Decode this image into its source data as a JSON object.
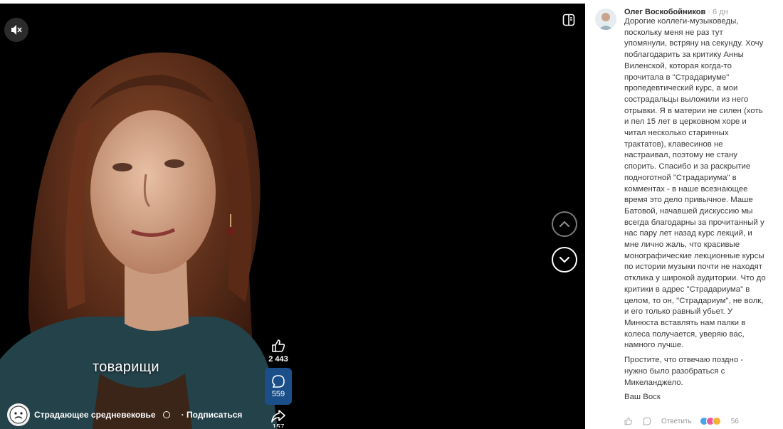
{
  "video": {
    "subtitle": "товарищи",
    "channel_name": "Страдающее средневековье",
    "subscribe_label": "· Подписаться",
    "likes_count": "2 443",
    "comments_count": "559",
    "shares_count": "157"
  },
  "comment": {
    "author": "Олег Воскобойников",
    "time": " · 6 дн",
    "paragraphs": [
      "Дорогие коллеги-музыковеды, поскольку меня не раз тут упомянули, встряну на секунду. Хочу поблагодарить за критику Анны Виленской, которая когда-то прочитала в \"Страдариуме\" пропедевтический курс, а мои сострадальцы выложили из него отрывки. Я в материи не силен (хоть и пел 15 лет в церковном хоре и читал несколько старинных трактатов), клавесинов не настраивал, поэтому не стану спорить. Спасибо и за раскрытие подноготной \"Страдариума\" в комментах - в наше всезнающее время это дело привычное. Маше Батовой, начавшей дискуссию мы всегда благодарны за прочитанный у нас пару лет назад курс лекций, и мне лично жаль, что красивые монографические лекционные курсы по истории музыки почти не находят отклика у широкой аудитории. Что до критики в адрес \"Страдариума\" в целом, то он, \"Страдариум\", не волк, и его только равный убьет. У Минюста вставлять нам палки в колеса получается, уверяю вас, намного лучше.",
      "Простите, что отвечаю поздно - нужно было разобраться с Микеланджело.",
      "Ваш Воск"
    ],
    "reply_label": "Ответить",
    "reactions_count": "56"
  },
  "colors": {
    "video_bg": "#000000",
    "comment_button": "#1a4f8a",
    "panel_bg": "#ffffff",
    "text": "#3a3a3a"
  },
  "icons": {
    "mute": "speaker-muted-icon",
    "layout": "panel-toggle-icon",
    "like": "thumbs-up-icon",
    "comment": "speech-bubble-icon",
    "share": "share-arrow-icon",
    "prev": "chevron-up-icon",
    "next": "chevron-down-icon"
  }
}
